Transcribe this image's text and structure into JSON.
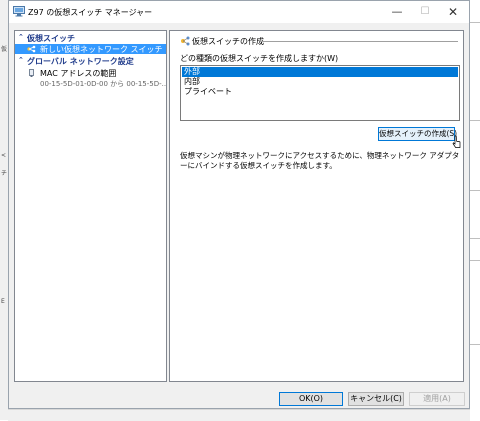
{
  "window": {
    "title": "Z97 の仮想スイッチ マネージャー",
    "minimize_glyph": "—",
    "maximize_glyph": "☐",
    "close_glyph": "✕"
  },
  "sidebar": {
    "virtual_switches_header": "仮想スイッチ",
    "new_switch_item": "新しい仮想ネットワーク スイッチ",
    "global_settings_header": "グローバル ネットワーク設定",
    "mac_range_item": "MAC アドレスの範囲",
    "mac_range_value": "00-15-5D-01-0D-00 から 00-15-5D-...",
    "header_chevron": "⌃"
  },
  "content": {
    "section_title": "仮想スイッチの作成",
    "question": "どの種類の仮想スイッチを作成しますか(W)",
    "switch_types": [
      "外部",
      "内部",
      "プライベート"
    ],
    "selected_index": 0,
    "create_button": "仮想スイッチの作成(S)",
    "description": "仮想マシンが物理ネットワークにアクセスするために、物理ネットワーク アダプターにバインドする仮想スイッチを作成します。"
  },
  "footer": {
    "ok": "OK(O)",
    "cancel": "キャンセル(C)",
    "apply": "適用(A)"
  },
  "icons": {
    "app": "hyper-v-manager-icon",
    "new_switch": "network-switch-icon",
    "mac": "network-adapter-icon",
    "section": "virtual-switch-icon",
    "cursor": "mouse-pointer-icon"
  },
  "colors": {
    "selection": "#3399ff",
    "list_selection": "#0078d7",
    "header_text": "#1e3a8a"
  }
}
